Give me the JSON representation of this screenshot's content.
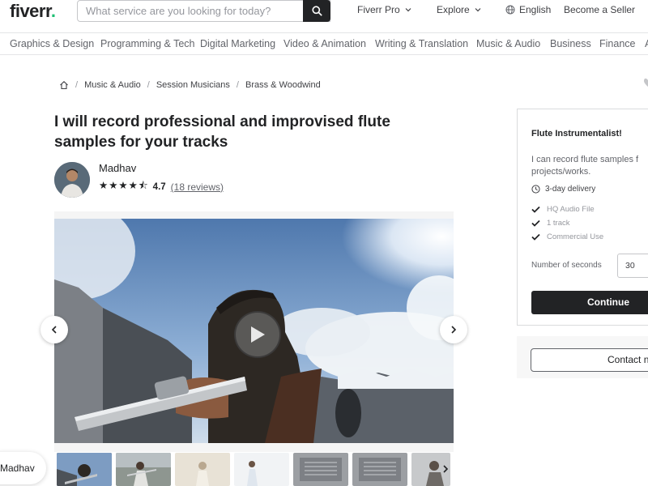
{
  "header": {
    "logo": "fiverr",
    "logo_dot": ".",
    "search_placeholder": "What service are you looking for today?",
    "nav": {
      "pro": "Fiverr Pro",
      "explore": "Explore",
      "language": "English",
      "become_seller": "Become a Seller"
    }
  },
  "categories": [
    "Graphics & Design",
    "Programming & Tech",
    "Digital Marketing",
    "Video & Animation",
    "Writing & Translation",
    "Music & Audio",
    "Business",
    "Finance",
    "A"
  ],
  "breadcrumb": [
    "Music & Audio",
    "Session Musicians",
    "Brass & Woodwind"
  ],
  "gig": {
    "title": "I will record professional and improvised flute samples for your tracks",
    "seller_name": "Madhav",
    "stars": "★★★★⯪",
    "rating": "4.7",
    "reviews": "(18 reviews)"
  },
  "chat_pill": "Madhav",
  "package": {
    "title": "Flute Instrumentalist!",
    "description": "I can record flute samples f projects/works.",
    "delivery": "3-day delivery",
    "features": [
      "HQ Audio File",
      "1 track",
      "Commercial Use"
    ],
    "number_label": "Number of seconds",
    "number_value": "30",
    "continue_label": "Continue",
    "contact_label": "Contact n"
  },
  "colors": {
    "brand_green": "#1dbf73",
    "dark": "#222325"
  }
}
